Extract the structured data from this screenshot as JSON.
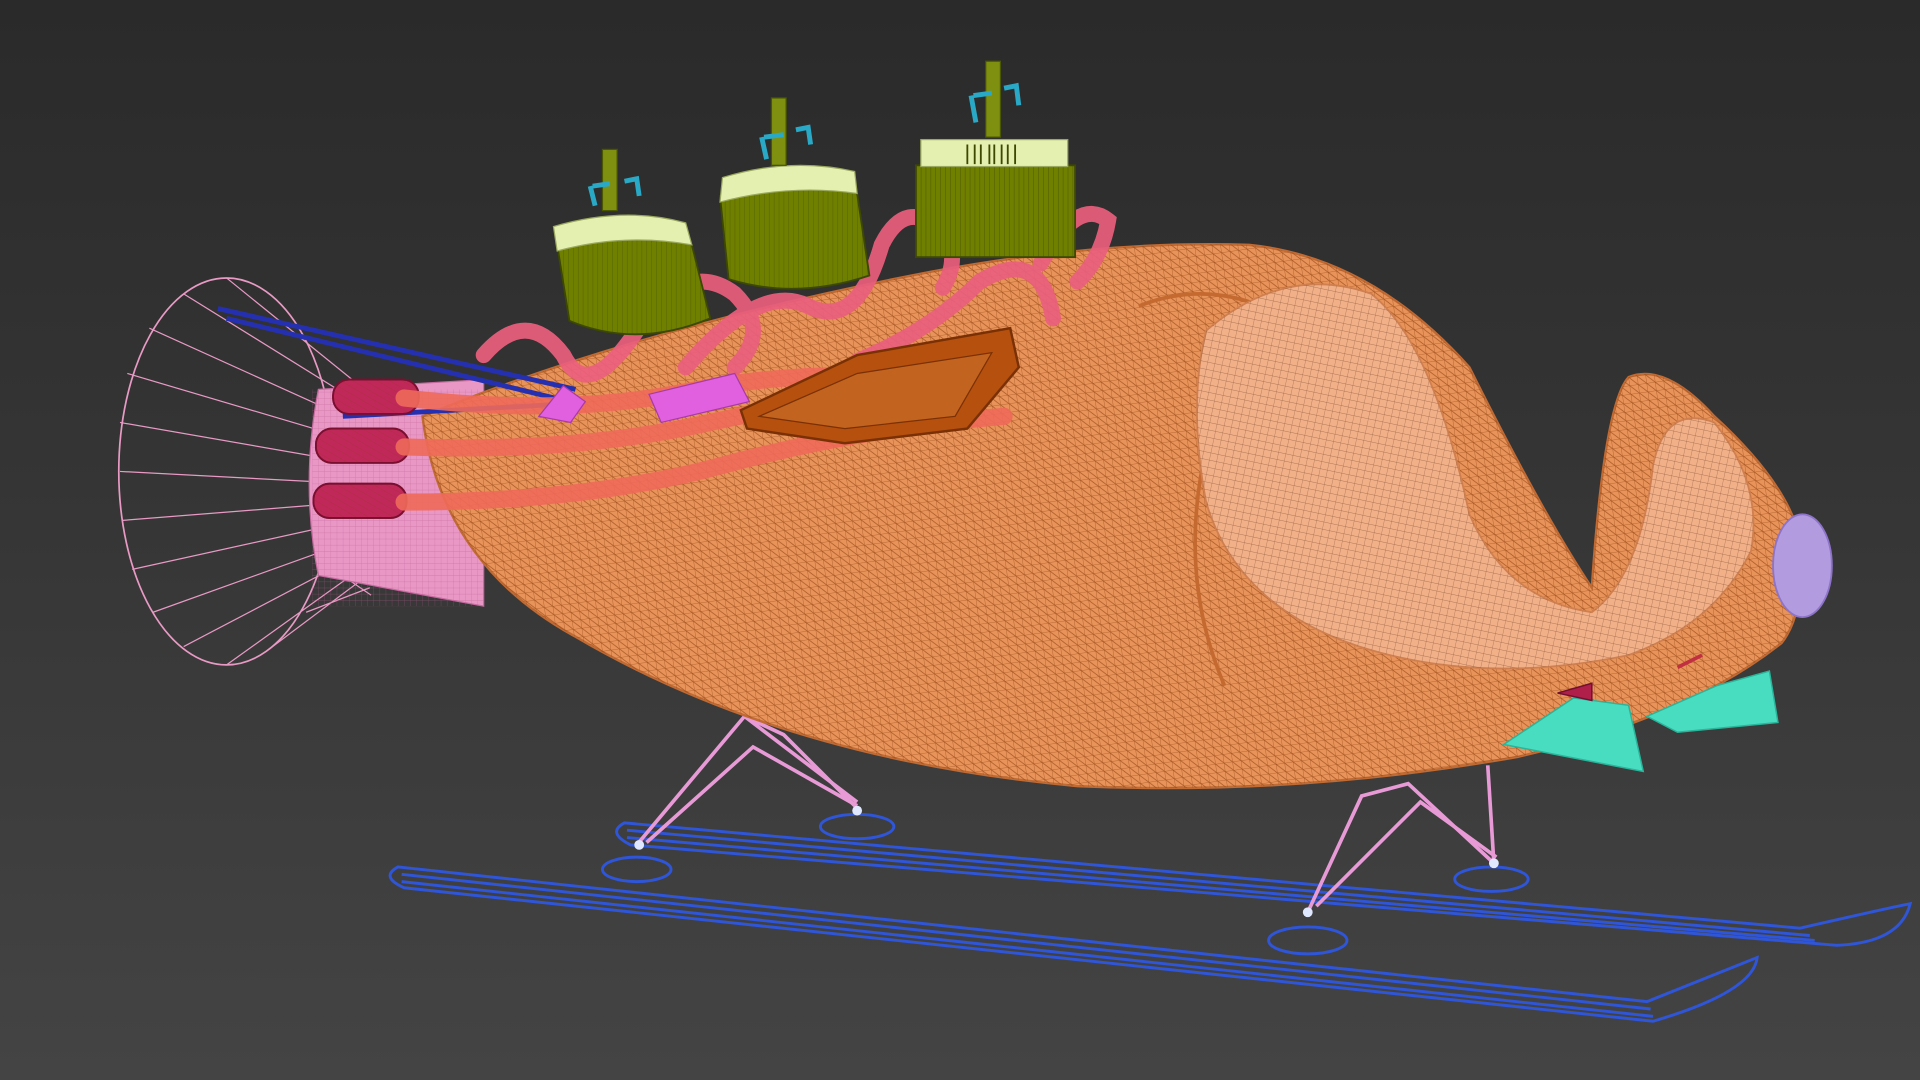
{
  "viewport": {
    "view_mode": "wireframe",
    "background": "#3a3a3a"
  },
  "scene_objects": [
    {
      "name": "bobsled-hull",
      "color": "#e8935a"
    },
    {
      "name": "cockpit-interior",
      "color": "#f2b089"
    },
    {
      "name": "nose-cap",
      "color": "#b39be0"
    },
    {
      "name": "rear-exhaust-cone",
      "color": "#e89ac4"
    },
    {
      "name": "rear-nozzles",
      "color": "#c0285a"
    },
    {
      "name": "exhaust-pipes",
      "color": "#ef6a5a"
    },
    {
      "name": "intake-ducts",
      "color": "#ea5f7e"
    },
    {
      "name": "side-intake",
      "color": "#b5500f"
    },
    {
      "name": "fuel-canisters",
      "color": "#6f7f00"
    },
    {
      "name": "canister-caps",
      "color": "#e4f0b0"
    },
    {
      "name": "canister-valves",
      "color": "#2aa9c6"
    },
    {
      "name": "front-fins",
      "color": "#48dcc0"
    },
    {
      "name": "landing-struts",
      "color": "#e79ad6"
    },
    {
      "name": "ski-runners",
      "color": "#2f55d8"
    },
    {
      "name": "blue-rods",
      "color": "#2530b0"
    },
    {
      "name": "magenta-panels",
      "color": "#e060e0"
    }
  ]
}
